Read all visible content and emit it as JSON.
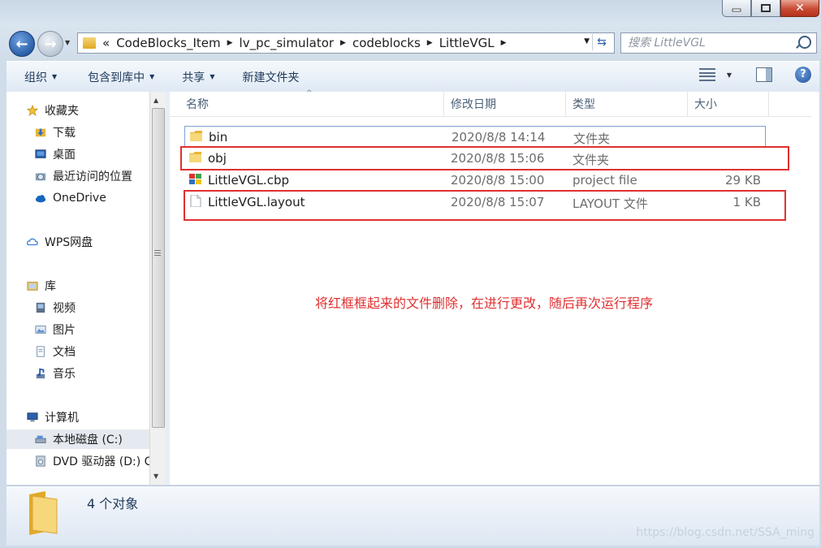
{
  "window": {
    "nav": {
      "address": {
        "overflow": "«",
        "segments": [
          "CodeBlocks_Item",
          "lv_pc_simulator",
          "codeblocks",
          "LittleVGL"
        ]
      },
      "search": {
        "placeholder": "搜索 LittleVGL"
      }
    },
    "toolbar": {
      "organize": "组织",
      "include_library": "包含到库中",
      "share": "共享",
      "new_folder": "新建文件夹",
      "help": "?"
    },
    "sidebar": {
      "favorites": "收藏夹",
      "favorites_items": [
        "下载",
        "桌面",
        "最近访问的位置"
      ],
      "onedrive": "OneDrive",
      "wps": "WPS网盘",
      "libraries": "库",
      "library_items": [
        "视频",
        "图片",
        "文档",
        "音乐"
      ],
      "computer": "计算机",
      "drives": [
        "本地磁盘 (C:)",
        "DVD 驱动器 (D:) C"
      ]
    },
    "columns": {
      "name": "名称",
      "date": "修改日期",
      "type": "类型",
      "size": "大小"
    },
    "files": [
      {
        "name": "bin",
        "date": "2020/8/8 14:14",
        "type": "文件夹",
        "size": "",
        "icon": "folder-icon"
      },
      {
        "name": "obj",
        "date": "2020/8/8 15:06",
        "type": "文件夹",
        "size": "",
        "icon": "folder-icon"
      },
      {
        "name": "LittleVGL.cbp",
        "date": "2020/8/8 15:00",
        "type": "project file",
        "size": "29 KB",
        "icon": "codeblocks-project-icon"
      },
      {
        "name": "LittleVGL.layout",
        "date": "2020/8/8 15:07",
        "type": "LAYOUT 文件",
        "size": "1 KB",
        "icon": "blank-file-icon"
      }
    ],
    "annotation": "将红框框起来的文件删除，在进行更改，随后再次运行程序",
    "status": {
      "count": "4 个对象"
    },
    "watermark": "https://blog.csdn.net/SSA_ming",
    "colors": {
      "annotation_red": "#e03030",
      "folder_yellow": "#e8b53a"
    }
  }
}
